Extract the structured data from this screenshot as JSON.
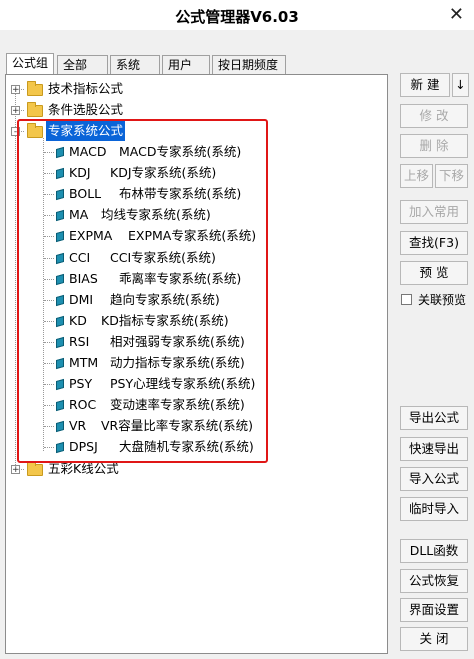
{
  "window": {
    "title": "公式管理器V6.03"
  },
  "tabs": [
    {
      "label": "公式组",
      "active": true
    },
    {
      "label": "全部",
      "active": false
    },
    {
      "label": "系统",
      "active": false
    },
    {
      "label": "用户",
      "active": false
    },
    {
      "label": "按日期频度",
      "active": false
    }
  ],
  "tree": {
    "groups": [
      {
        "label": "技术指标公式",
        "expander": "+"
      },
      {
        "label": "条件选股公式",
        "expander": "+"
      },
      {
        "label": "专家系统公式",
        "expander": "-",
        "selected": true
      },
      {
        "label": "五彩K线公式",
        "expander": "+"
      }
    ],
    "expert_items": [
      {
        "code": "MACD",
        "desc": "MACD专家系统(系统)"
      },
      {
        "code": "KDJ",
        "desc": "KDJ专家系统(系统)"
      },
      {
        "code": "BOLL",
        "desc": "布林带专家系统(系统)"
      },
      {
        "code": "MA",
        "desc": "均线专家系统(系统)"
      },
      {
        "code": "EXPMA",
        "desc": "EXPMA专家系统(系统)"
      },
      {
        "code": "CCI",
        "desc": "CCI专家系统(系统)"
      },
      {
        "code": "BIAS",
        "desc": "乖离率专家系统(系统)"
      },
      {
        "code": "DMI",
        "desc": "趋向专家系统(系统)"
      },
      {
        "code": "KD",
        "desc": "KD指标专家系统(系统)"
      },
      {
        "code": "RSI",
        "desc": "相对强弱专家系统(系统)"
      },
      {
        "code": "MTM",
        "desc": "动力指标专家系统(系统)"
      },
      {
        "code": "PSY",
        "desc": "PSY心理线专家系统(系统)"
      },
      {
        "code": "ROC",
        "desc": "变动速率专家系统(系统)"
      },
      {
        "code": "VR",
        "desc": "VR容量比率专家系统(系统)"
      },
      {
        "code": "DPSJ",
        "desc": "大盘随机专家系统(系统)"
      }
    ]
  },
  "buttons": {
    "new": "新 建",
    "new_arrow": "↓",
    "modify": "修 改",
    "delete": "删 除",
    "move_up": "上移",
    "move_down": "下移",
    "add_common": "加入常用",
    "find": "查找(F3)",
    "preview": "预 览",
    "linked_preview": "关联预览",
    "export": "导出公式",
    "quick_export": "快速导出",
    "import": "导入公式",
    "temp_import": "临时导入",
    "dll": "DLL函数",
    "restore": "公式恢复",
    "ui_settings": "界面设置",
    "close": "关 闭"
  },
  "colors": {
    "selection": "#0a64d8",
    "highlight_box": "#e01616",
    "gem_icon": "#1d8fb0",
    "folder_icon": "#f3c64a"
  }
}
